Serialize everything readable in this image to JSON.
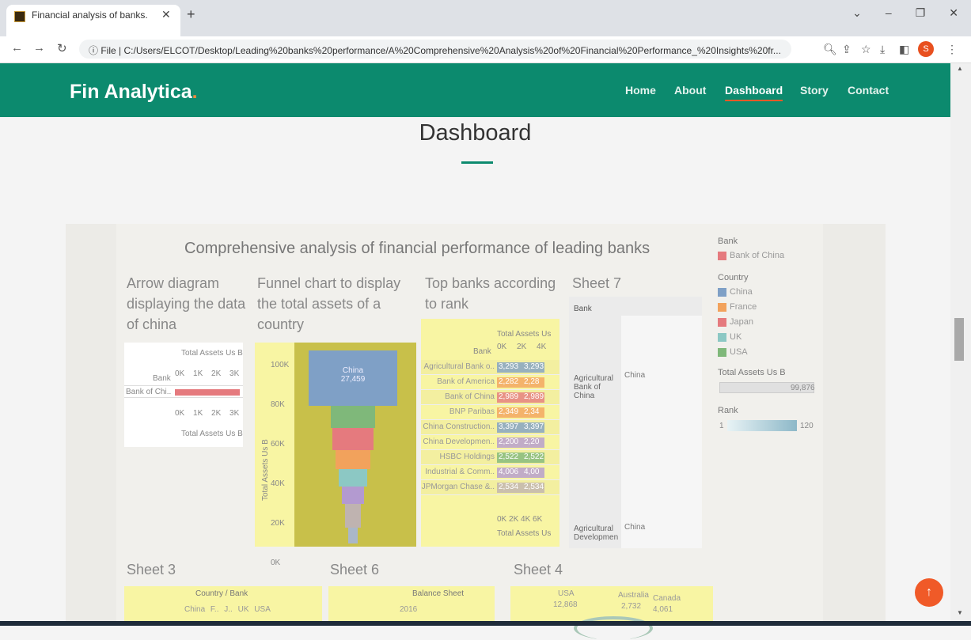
{
  "browser": {
    "tab_title": "Financial analysis of banks.",
    "url": "C:/Users/ELCOT/Desktop/Leading%20banks%20performance/A%20Comprehensive%20Analysis%20of%20Financial%20Performance_%20Insights%20fr...",
    "file_label": "File",
    "profile_initial": "S"
  },
  "navbar": {
    "logo": "Fin Analytica",
    "logo_dot": ".",
    "items": [
      "Home",
      "About",
      "Dashboard",
      "Story",
      "Contact"
    ],
    "active": "Dashboard"
  },
  "page": {
    "title": "Dashboard"
  },
  "dashboard": {
    "title": "Comprehensive analysis of financial performance of leading banks",
    "arrow": {
      "title": "Arrow diagram displaying the data of china",
      "axis_title": "Total Assets Us B",
      "bank_label": "Bank",
      "ticks": [
        "0K",
        "1K",
        "2K",
        "3K"
      ],
      "row": "Bank of Chi.."
    },
    "funnel": {
      "title": "Funnel chart to display the total assets of a country",
      "yaxis": "Total Assets Us B",
      "ticks": [
        "100K",
        "80K",
        "60K",
        "40K",
        "20K",
        "0K"
      ],
      "top_label": "China",
      "top_value": "27,459"
    },
    "topbanks": {
      "title": "Top banks according to rank",
      "axis_title": "Total Assets Us",
      "bank_label": "Bank",
      "ticks": [
        "0K",
        "2K",
        "4K"
      ],
      "bottom_ticks": "0K 2K 4K 6K",
      "bottom_title": "Total Assets Us",
      "banks": [
        {
          "name": "Agricultural Bank o..",
          "v1": "3,293",
          "v2": "3,293"
        },
        {
          "name": "Bank of America",
          "v1": "2,282",
          "v2": "2,28"
        },
        {
          "name": "Bank of China",
          "v1": "2,989",
          "v2": "2,989"
        },
        {
          "name": "BNP Paribas",
          "v1": "2,349",
          "v2": "2,34"
        },
        {
          "name": "China Construction..",
          "v1": "3,397",
          "v2": "3,397"
        },
        {
          "name": "China Developmen..",
          "v1": "2,200",
          "v2": "2,20"
        },
        {
          "name": "HSBC Holdings",
          "v1": "2,522",
          "v2": "2,522"
        },
        {
          "name": "Industrial & Comm..",
          "v1": "4,006",
          "v2": "4,00"
        },
        {
          "name": "JPMorgan Chase &..",
          "v1": "2,534",
          "v2": "2,534"
        }
      ]
    },
    "sheet7": {
      "title": "Sheet 7",
      "bank_header": "Bank",
      "row1": "Agricultural Bank of China",
      "row2": "Agricultural Developmen",
      "pin": "China"
    },
    "legend": {
      "bank_title": "Bank",
      "bank_item": "Bank of China",
      "country_title": "Country",
      "countries": [
        "China",
        "France",
        "Japan",
        "UK",
        "USA"
      ],
      "assets_title": "Total Assets Us B",
      "assets_value": "99,876",
      "rank_title": "Rank",
      "rank_min": "1",
      "rank_max": "120"
    },
    "sheet3": {
      "title": "Sheet 3",
      "header": "Country / Bank",
      "cols": [
        "China",
        "F..",
        "J..",
        "UK",
        "USA"
      ]
    },
    "sheet6": {
      "title": "Sheet 6",
      "header": "Balance Sheet",
      "year": "2016"
    },
    "sheet4": {
      "title": "Sheet 4",
      "l1": "USA",
      "v1": "12,868",
      "l2": "Australia",
      "v2": "2,732",
      "l3": "Canada",
      "v3": "4,061"
    }
  },
  "colors": {
    "teal": "#0c8a6e",
    "orange": "#f05a28",
    "china": "#7fa0c6",
    "france": "#f2a25c",
    "japan": "#e57a7e",
    "uk": "#8cc8c4",
    "usa": "#7fb87a"
  }
}
